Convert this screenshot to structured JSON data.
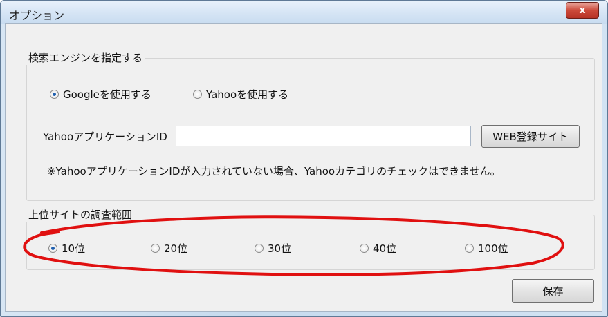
{
  "window": {
    "title": "オプション",
    "close_label": "x"
  },
  "search_engine": {
    "group_label": "検索エンジンを指定する",
    "options": [
      {
        "label": "Googleを使用する",
        "checked": true
      },
      {
        "label": "Yahooを使用する",
        "checked": false
      }
    ],
    "app_id_label": "YahooアプリケーションID",
    "app_id_value": "",
    "web_register_button": "WEB登録サイト",
    "note": "※YahooアプリケーションIDが入力されていない場合、Yahooカテゴリのチェックはできません。"
  },
  "top_sites": {
    "group_label": "上位サイトの調査範囲",
    "options": [
      {
        "label": "10位",
        "checked": true
      },
      {
        "label": "20位",
        "checked": false
      },
      {
        "label": "30位",
        "checked": false
      },
      {
        "label": "40位",
        "checked": false
      },
      {
        "label": "100位",
        "checked": false
      }
    ]
  },
  "save_button": "保存",
  "annotation_color": "#e01010"
}
